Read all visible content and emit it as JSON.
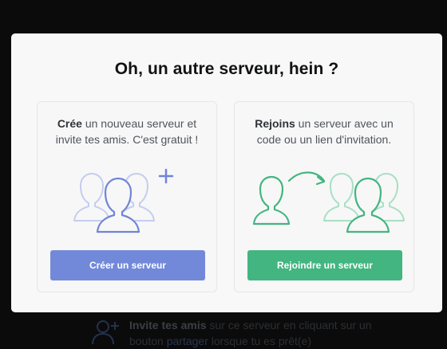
{
  "backdrop": {
    "invite_strong": "Invite tes amis",
    "invite_rest": " sur ce serveur en cliquant sur un",
    "line2_before": "bouton ",
    "line2_link": "partager",
    "line2_after": " lorsque tu es prêt(e)"
  },
  "modal": {
    "title": "Oh, un autre serveur, hein ?",
    "create": {
      "lead": "Crée",
      "text": " un nouveau serveur et invite tes amis. C'est gratuit !",
      "button": "Créer un serveur",
      "icon": "users-plus-icon",
      "color": "#7289da"
    },
    "join": {
      "lead": "Rejoins",
      "text": " un serveur avec un code ou un lien d'invitation.",
      "button": "Rejoindre un serveur",
      "icon": "user-join-group-icon",
      "color": "#43b581"
    }
  }
}
